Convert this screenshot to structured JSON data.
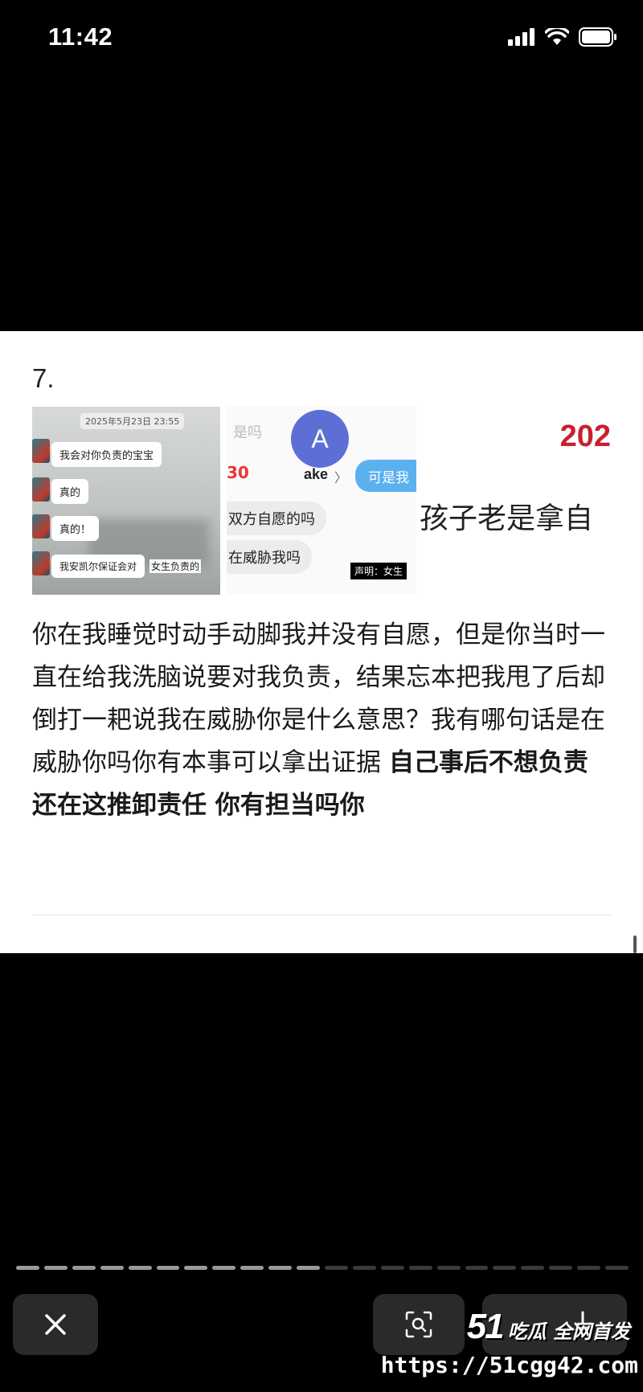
{
  "status_bar": {
    "time": "11:42",
    "icons": [
      "cellular-signal-icon",
      "wifi-icon",
      "battery-icon"
    ]
  },
  "post": {
    "item_number": "7.",
    "screenshots": {
      "chat": {
        "date": "2025年5月23日 23:55",
        "messages": [
          "我会对你负责的宝宝",
          "真的",
          "真的！",
          "我安凯尔保证会对"
        ],
        "overlay_tag": "女生",
        "overlay_tail": "负责的"
      },
      "middle": {
        "faded_text": "是吗",
        "red_number": "30",
        "avatar_letter": "A",
        "name": "ake",
        "name_chevron": "〉",
        "blue_bubble": "可是我",
        "grey_bubbles": [
          "双方自愿的吗",
          "在威胁我吗"
        ]
      },
      "right": {
        "year": "202",
        "headline": "孩子老是拿自",
        "disclaimer": "声明：女生"
      }
    },
    "paragraph_normal": "你在我睡觉时动手动脚我并没有自愿，但是你当时一直在给我洗脑说要对我负责，结果忘本把我甩了后却倒打一耙说我在威胁你是什么意思？我有哪句话是在威胁你吗你有本事可以拿出证据 ",
    "paragraph_bold": "自己事后不想负责还在这推卸责任 你有担当吗你"
  },
  "viewer": {
    "progress_segments_total": 22,
    "progress_segments_done": 11,
    "close_icon": "close-icon",
    "lens_icon": "visual-lookup-icon",
    "download_icon": "download-icon"
  },
  "watermark": {
    "logo_number": "51",
    "logo_text": "吃瓜 全网首发",
    "url": "https://51cgg42.com"
  },
  "colors": {
    "background": "#000000",
    "card": "#ffffff",
    "accent_red": "#c9202c",
    "bubble_blue": "#5bb1f0",
    "avatar_purple": "#5d6fd6"
  }
}
